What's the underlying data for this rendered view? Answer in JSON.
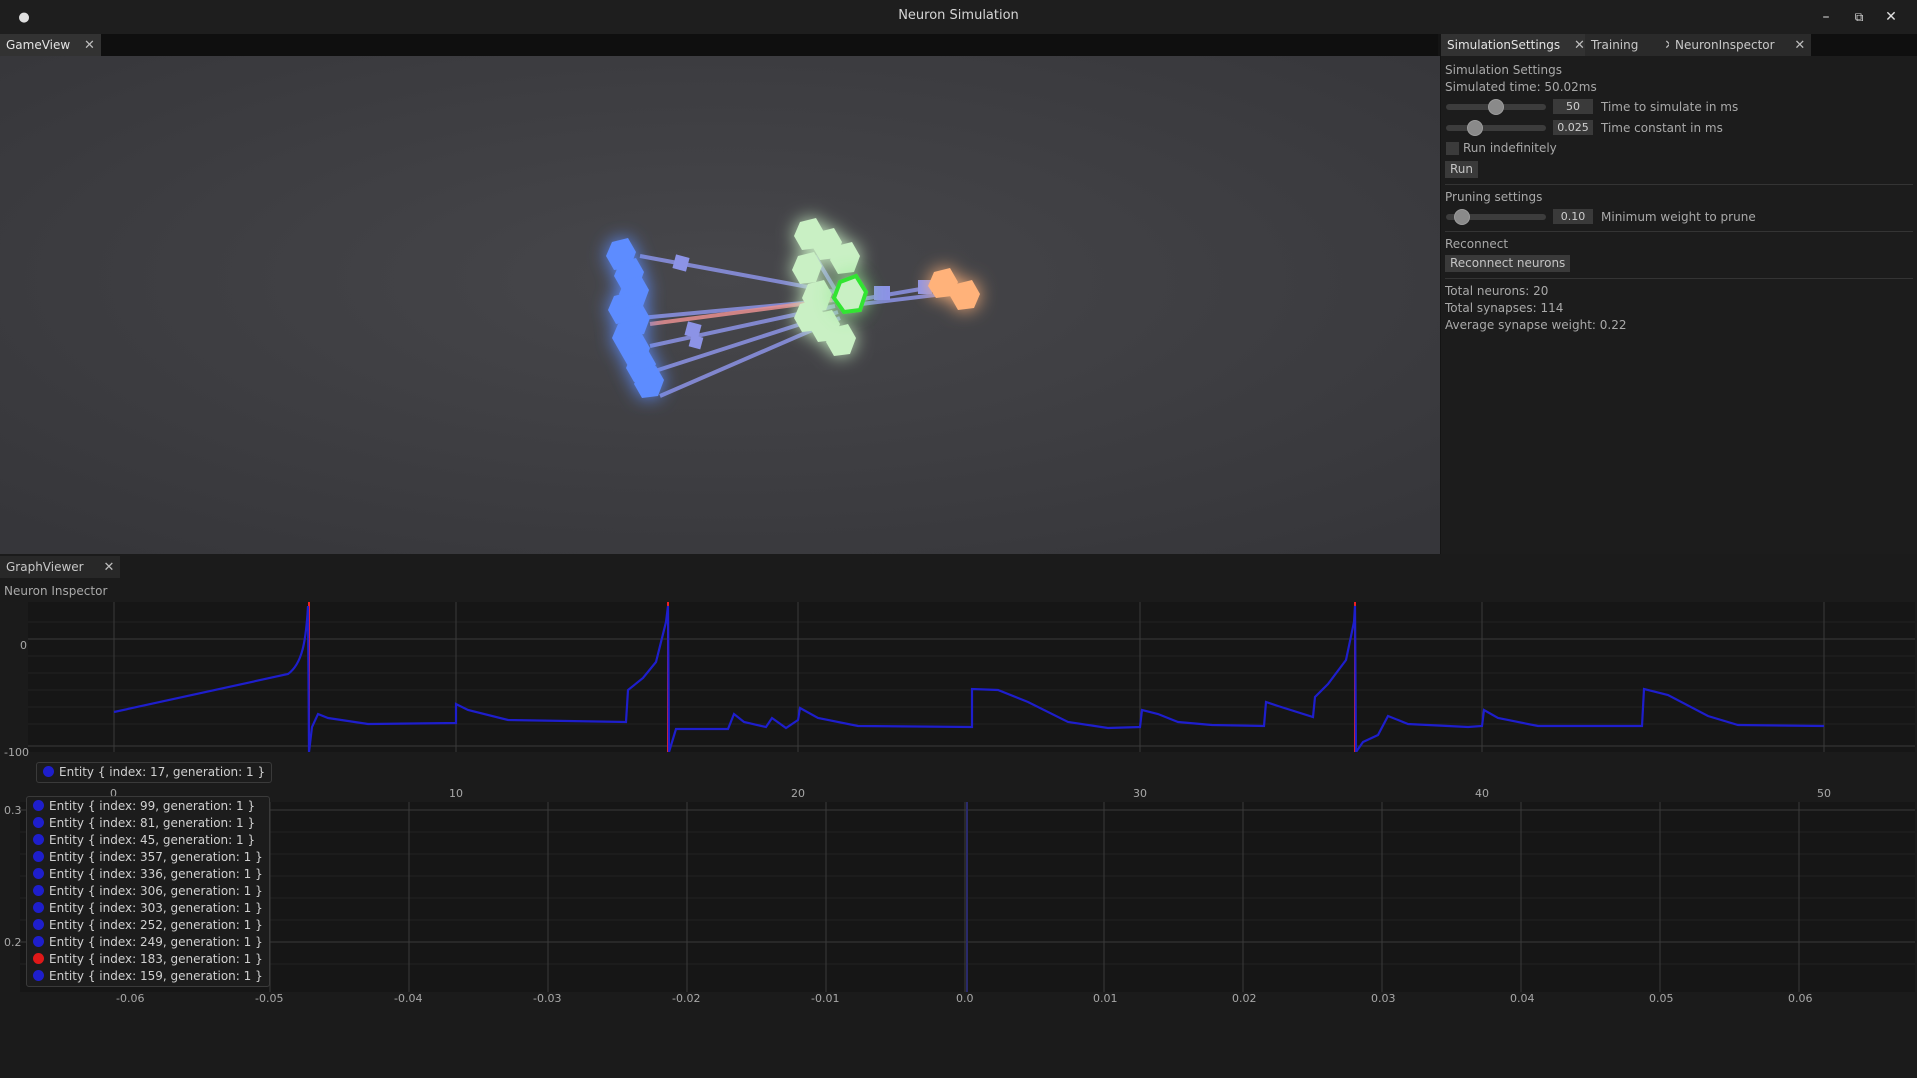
{
  "window": {
    "title": "Neuron Simulation",
    "menu_glyph": "●",
    "minimize_glyph": "–",
    "maximize_glyph": "⧉",
    "close_glyph": "✕"
  },
  "top_tabs": {
    "gameview": "GameView",
    "close_glyph": "✕"
  },
  "side_tabs": [
    "SimulationSettings",
    "Training",
    "NeuronInspector"
  ],
  "sim_settings": {
    "heading": "Simulation Settings",
    "simulated_time": "Simulated time: 50.02ms",
    "time_to_simulate": {
      "value": "50",
      "label": "Time to simulate in ms",
      "fraction": 0.5
    },
    "time_constant": {
      "value": "0.025",
      "label": "Time constant in ms",
      "fraction": 0.25
    },
    "run_indefinitely": {
      "label": "Run indefinitely",
      "checked": false
    },
    "run_button": "Run",
    "pruning_heading": "Pruning settings",
    "min_weight": {
      "value": "0.10",
      "label": "Minimum weight to prune",
      "fraction": 0.1
    },
    "reconnect_heading": "Reconnect",
    "reconnect_button": "Reconnect neurons",
    "stats": [
      "Total neurons: 20",
      "Total synapses: 114",
      "Average synapse weight: 0.22"
    ]
  },
  "graph_tabs": {
    "graphviewer": "GraphViewer"
  },
  "neuron_inspector": {
    "title": "Neuron Inspector",
    "y_ticks": [
      "0",
      "-100"
    ],
    "x_ticks": [
      "0",
      "10",
      "20",
      "30",
      "40",
      "50"
    ],
    "legend": [
      {
        "label": "Entity { index: 17, generation: 1 }",
        "color": "#1e1ecc"
      }
    ],
    "spike_times_ms": [
      5.7,
      16.2,
      36.3
    ]
  },
  "lower_plot": {
    "y_ticks": [
      "0.3",
      "0.2"
    ],
    "x_ticks": [
      "-0.06",
      "-0.05",
      "-0.04",
      "-0.03",
      "-0.02",
      "-0.01",
      "0.0",
      "0.01",
      "0.02",
      "0.03",
      "0.04",
      "0.05",
      "0.06"
    ],
    "legend": [
      {
        "label": "Entity { index: 99, generation: 1 }",
        "color": "#1e1ecc"
      },
      {
        "label": "Entity { index: 81, generation: 1 }",
        "color": "#1e1ecc"
      },
      {
        "label": "Entity { index: 45, generation: 1 }",
        "color": "#1e1ecc"
      },
      {
        "label": "Entity { index: 357, generation: 1 }",
        "color": "#1e1ecc"
      },
      {
        "label": "Entity { index: 336, generation: 1 }",
        "color": "#1e1ecc"
      },
      {
        "label": "Entity { index: 306, generation: 1 }",
        "color": "#1e1ecc"
      },
      {
        "label": "Entity { index: 303, generation: 1 }",
        "color": "#1e1ecc"
      },
      {
        "label": "Entity { index: 252, generation: 1 }",
        "color": "#1e1ecc"
      },
      {
        "label": "Entity { index: 249, generation: 1 }",
        "color": "#1e1ecc"
      },
      {
        "label": "Entity { index: 183, generation: 1 }",
        "color": "#e01818"
      },
      {
        "label": "Entity { index: 159, generation: 1 }",
        "color": "#1e1ecc"
      }
    ]
  },
  "colors": {
    "trace": "#1e1ecc",
    "spike": "#e01818",
    "accent_green": "#3cff3c"
  }
}
